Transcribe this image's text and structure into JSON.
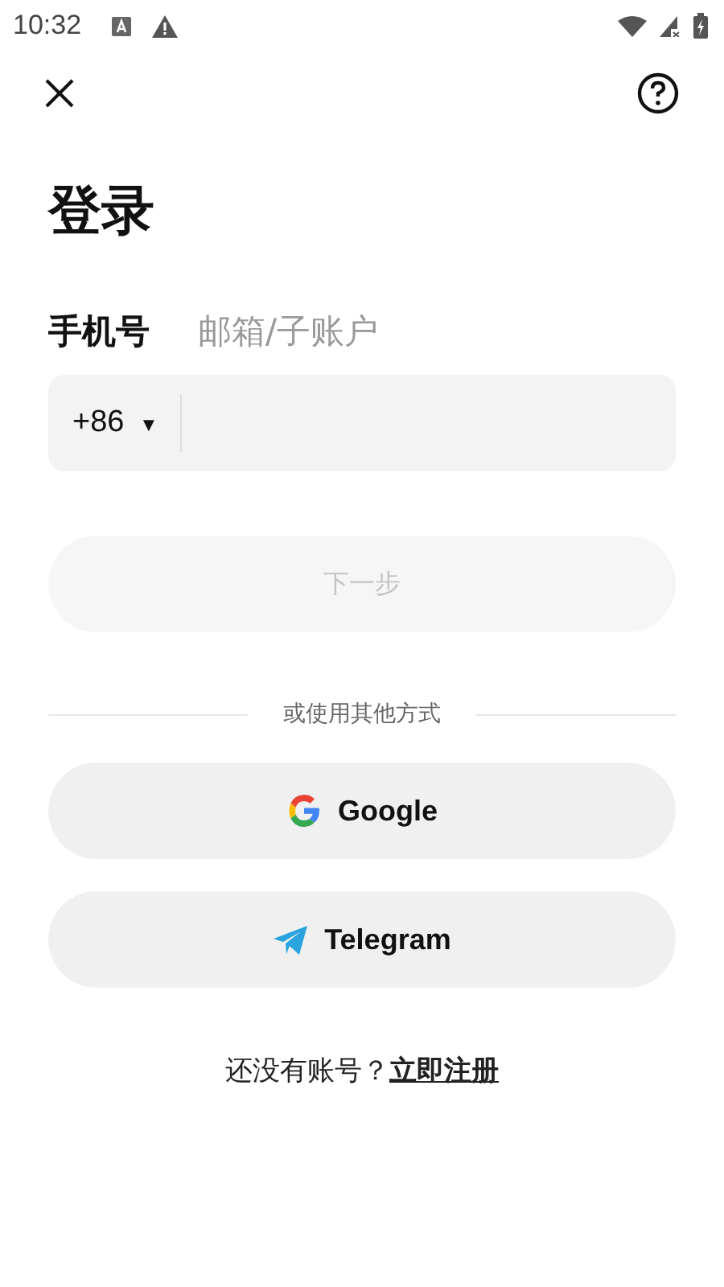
{
  "status_bar": {
    "time": "10:32"
  },
  "title": "登录",
  "tabs": [
    {
      "label": "手机号",
      "selected": true
    },
    {
      "label": "邮箱/子账户",
      "selected": false
    }
  ],
  "phone_field": {
    "country_code": "+86",
    "caret": "▼"
  },
  "next_button": {
    "label": "下一步",
    "disabled": true
  },
  "divider_text": "或使用其他方式",
  "social_buttons": [
    {
      "kind": "google",
      "label": "Google"
    },
    {
      "kind": "telegram",
      "label": "Telegram"
    }
  ],
  "signup": {
    "prompt": "还没有账号？",
    "link": "立即注册"
  }
}
